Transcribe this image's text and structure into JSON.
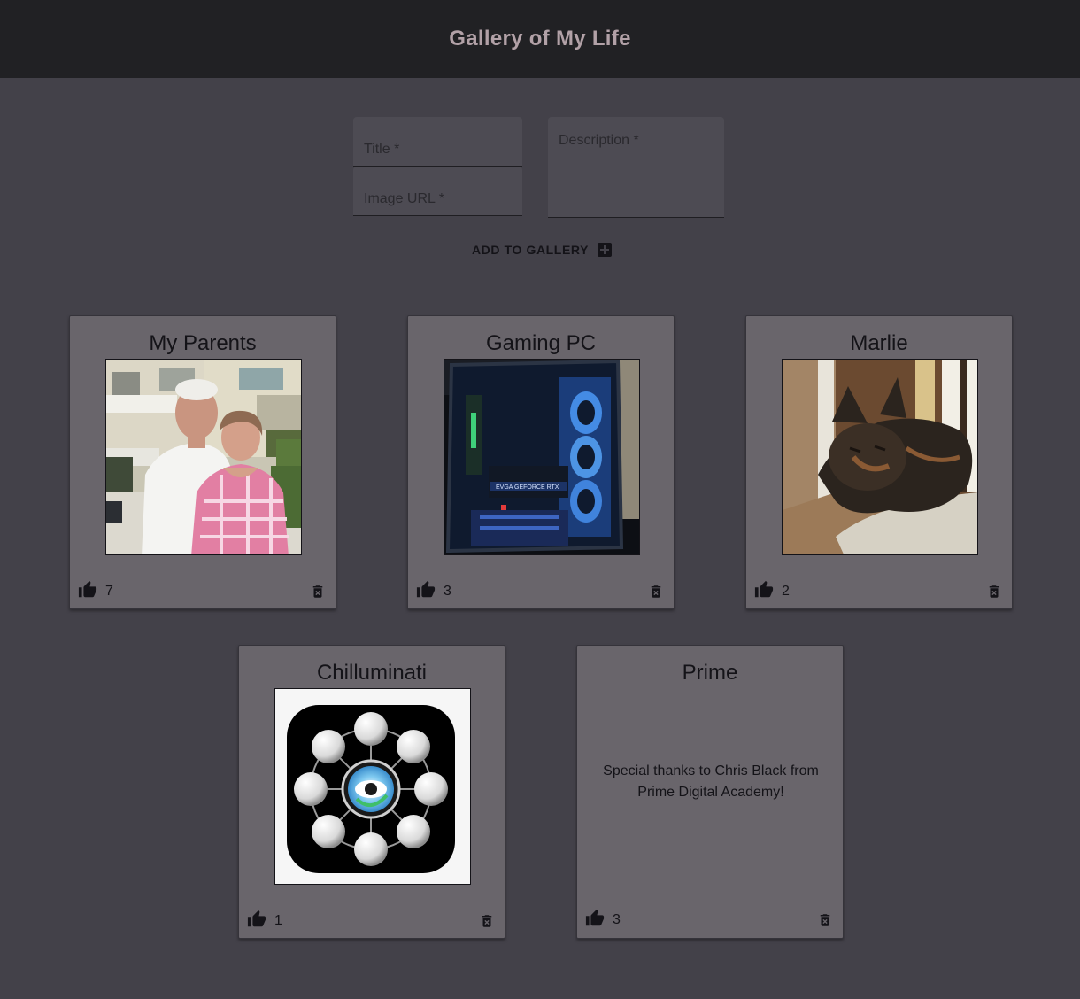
{
  "header": {
    "title": "Gallery of My Life"
  },
  "form": {
    "title_placeholder": "Title *",
    "url_placeholder": "Image URL *",
    "description_placeholder": "Description *",
    "add_label": "ADD TO GALLERY"
  },
  "cards": [
    {
      "title": "My Parents",
      "likes": "7",
      "image": "parents-photo"
    },
    {
      "title": "Gaming PC",
      "likes": "3",
      "image": "gaming-pc-photo"
    },
    {
      "title": "Marlie",
      "likes": "2",
      "image": "cat-photo"
    },
    {
      "title": "Chilluminati",
      "likes": "1",
      "image": "chilluminati-logo"
    },
    {
      "title": "Prime",
      "likes": "3",
      "description": "Special thanks to Chris Black from Prime Digital Academy!"
    }
  ],
  "colors": {
    "background": "#434149",
    "header": "#212124",
    "header_text": "#b2a1a7",
    "card": "#69656b"
  }
}
